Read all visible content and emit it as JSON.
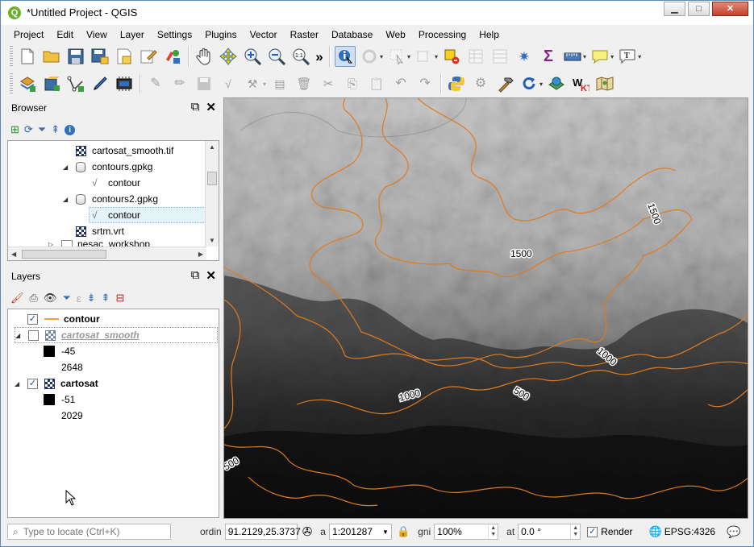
{
  "window": {
    "title": "*Untitled Project - QGIS",
    "app_icon": "Q",
    "controls": {
      "minimize": "▁",
      "maximize": "□",
      "close": "✕"
    }
  },
  "menubar": {
    "items": [
      "Project",
      "Edit",
      "View",
      "Layer",
      "Settings",
      "Plugins",
      "Vector",
      "Raster",
      "Database",
      "Web",
      "Processing",
      "Help"
    ]
  },
  "toolbar1": {
    "overflow": "»",
    "icons": [
      "new-project-icon",
      "open-project-icon",
      "save-project-icon",
      "save-as-icon",
      "new-print-layout-icon",
      "layout-manager-icon",
      "style-manager-icon",
      "pan-icon",
      "pan-to-selection-icon",
      "zoom-in-icon",
      "zoom-out-icon",
      "zoom-native-icon",
      "identify-icon",
      "action-icon",
      "select-icon",
      "deselect-icon",
      "open-table-icon",
      "statistics-icon",
      "settings-icon",
      "sum-icon",
      "measure-icon",
      "annotation-icon",
      "text-annotation-icon"
    ]
  },
  "toolbar2": {
    "icons": [
      "add-layer-icon",
      "add-vector-icon",
      "digitize-icon",
      "edit-pencil-icon",
      "save-edits-icon",
      "python-icon",
      "plugin-icon",
      "refresh-icon",
      "globe-icon",
      "wkt-icon",
      "map-icon"
    ]
  },
  "browser": {
    "title": "Browser",
    "tree": [
      {
        "label": "cartosat_smooth.tif",
        "type": "raster",
        "indent": 3
      },
      {
        "label": "contours.gpkg",
        "type": "gpkg",
        "indent": 2,
        "expanded": true
      },
      {
        "label": "contour",
        "type": "line",
        "indent": 3
      },
      {
        "label": "contours2.gpkg",
        "type": "gpkg",
        "indent": 2,
        "expanded": true
      },
      {
        "label": "contour",
        "type": "line",
        "indent": 3,
        "selected": true
      },
      {
        "label": "srtm.vrt",
        "type": "raster",
        "indent": 2
      },
      {
        "label": "nesac_workshop",
        "type": "folder",
        "indent": 1
      }
    ]
  },
  "layers": {
    "title": "Layers",
    "items": [
      {
        "label": "contour",
        "checked": true,
        "kind": "line"
      },
      {
        "label": "cartosat_smooth",
        "checked": false,
        "kind": "raster",
        "min": "-45",
        "max": "2648"
      },
      {
        "label": "cartosat",
        "checked": true,
        "kind": "raster",
        "min": "-51",
        "max": "2029"
      }
    ]
  },
  "map": {
    "contour_color": "#e07a1f",
    "labels": [
      {
        "text": "1500"
      },
      {
        "text": "1500"
      },
      {
        "text": "1000"
      },
      {
        "text": "1000"
      },
      {
        "text": "500"
      },
      {
        "text": "500"
      }
    ]
  },
  "statusbar": {
    "locate_placeholder": "Type to locate (Ctrl+K)",
    "coord_label": "ordin",
    "coordinate": "91.2129,25.3737",
    "scale_label": "a",
    "scale": "1:201287",
    "magnifier_label": "gni",
    "magnifier": "100%",
    "rotation_label": "at",
    "rotation": "0.0 °",
    "render_label": "Render",
    "render_checked": true,
    "crs": "EPSG:4326"
  }
}
